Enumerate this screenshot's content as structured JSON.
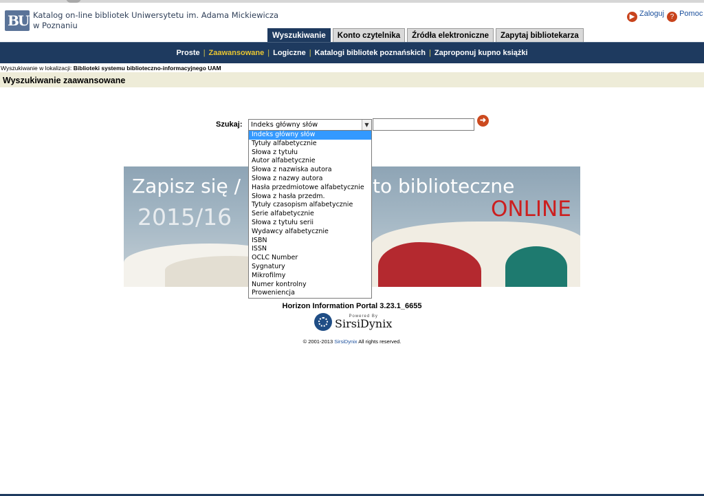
{
  "header": {
    "title_line1": "Katalog on-line bibliotek Uniwersytetu im. Adama Mickiewicza",
    "title_line2": "w Poznaniu",
    "logo_text": "BU",
    "login_label": "Zaloguj",
    "help_label": "Pomoc"
  },
  "tabs": [
    {
      "label": "Wyszukiwanie",
      "active": true
    },
    {
      "label": "Konto czytelnika",
      "active": false
    },
    {
      "label": "Źródła elektroniczne",
      "active": false
    },
    {
      "label": "Zapytaj bibliotekarza",
      "active": false
    }
  ],
  "subnav": [
    {
      "label": "Proste"
    },
    {
      "label": "Zaawansowane",
      "current": true
    },
    {
      "label": "Logiczne"
    },
    {
      "label": "Katalogi bibliotek poznańskich"
    },
    {
      "label": "Zaproponuj kupno książki"
    }
  ],
  "location": {
    "prefix": "Wyszukiwanie w lokalizacji:",
    "name": "Biblioteki systemu biblioteczno-informacyjnego UAM"
  },
  "page_title": "Wyszukiwanie zaawansowane",
  "search": {
    "label": "Szukaj:",
    "selected": "Indeks główny słów",
    "input_value": "",
    "options": [
      "Indeks główny słów",
      "Tytuły alfabetycznie",
      "Słowa z tytułu",
      "Autor alfabetycznie",
      "Słowa z nazwiska autora",
      "Słowa z nazwy autora",
      "Hasła przedmiotowe alfabetycznie",
      "Słowa z hasła przedm.",
      "Tytuły czasopism alfabetycznie",
      "Serie alfabetycznie",
      "Słowa z tytułu serii",
      "Wydawcy alfabetycznie",
      "ISBN",
      "ISSN",
      "OCLC Number",
      "Sygnatury",
      "Mikrofilmy",
      "Numer kontrolny",
      "Proweniencja"
    ]
  },
  "banner": {
    "line1_left": "Zapisz się /",
    "line1_right": "to biblioteczne",
    "year": "2015/16",
    "online": "ONLINE"
  },
  "footer": {
    "portal": "Horizon Information Portal 3.23.1_6655",
    "powered_by": "Powered By",
    "brand": "SirsiDynix",
    "copyright_pre": "© 2001-2013",
    "copyright_link": "SirsiDynix",
    "copyright_post": "All rights reserved."
  },
  "colors": {
    "navbar": "#1e3a5f",
    "accent": "#cc4a1f",
    "current_subnav": "#e8c532",
    "selected_option": "#3399ff"
  }
}
